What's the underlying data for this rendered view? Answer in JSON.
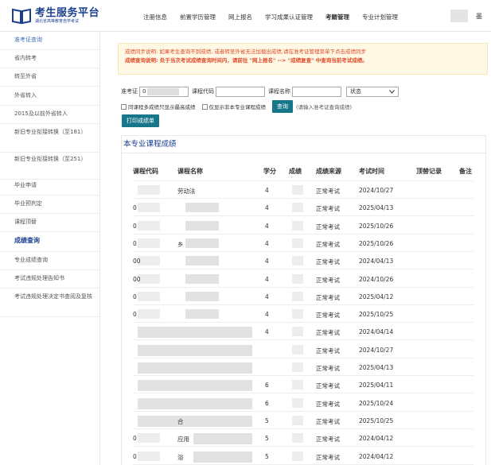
{
  "header": {
    "logo_title": "考生服务平台",
    "logo_subtitle": "湖北省高等教育自学考试",
    "nav": [
      "注册信息",
      "前置学历管理",
      "网上报名",
      "学习成果认证管理",
      "考籍管理",
      "专业计划管理"
    ],
    "active_nav": "考籍管理",
    "user_trailing_char": "墨"
  },
  "sidebar": {
    "items": [
      "准考证查询",
      "省内转考",
      "转至外省",
      "外省转入",
      "2015及以前外省转入",
      "新旧专业衔接转换（至181）",
      "新旧专业衔接转换（至251）",
      "毕业申请",
      "毕业预判定",
      "课程顶替",
      "成绩查询",
      "专业成绩查询",
      "考试违规处理告知书",
      "考试违规处理决定书查阅及复核"
    ],
    "active_index": 10
  },
  "notice": {
    "line1": "成绩同步说明: 如果考生查询不到成绩, 或者转至外省无法加载出成绩,请在准考证管理菜单下点击成绩同步",
    "line2": "成绩查询说明: 处于当次考试成绩查询时间内，请前往 \"网上报名\" --> \"成绩复查\" 中查询当前考试成绩。"
  },
  "search": {
    "id_label": "准考证",
    "id_value": "0",
    "code_label": "课程代码",
    "code_value": "",
    "name_label": "课程名称",
    "name_value": "",
    "status_value": "状态",
    "check1_label": "同课程多成绩只显示最高成绩",
    "check2_label": "仅显示非本专业课程成绩",
    "query_button": "查询",
    "hint": "(请输入准考证查询成绩)",
    "print_button": "打印成绩单"
  },
  "panel": {
    "title": "本专业课程成绩",
    "columns": [
      "课程代码",
      "课程名称",
      "学分",
      "成绩",
      "成绩来源",
      "考试时间",
      "顶替记录",
      "备注"
    ],
    "rows": [
      {
        "code": "",
        "name": "劳动法",
        "credit": "4",
        "source": "正常考试",
        "time": "2024/10/27"
      },
      {
        "code": "0",
        "name": "",
        "credit": "4",
        "source": "正常考试",
        "time": "2025/04/13"
      },
      {
        "code": "0",
        "name": "",
        "credit": "4",
        "source": "正常考试",
        "time": "2025/10/26"
      },
      {
        "code": "0",
        "name": "乡",
        "credit": "4",
        "source": "正常考试",
        "time": "2025/10/26"
      },
      {
        "code": "00",
        "name": "",
        "credit": "4",
        "source": "正常考试",
        "time": "2024/04/13"
      },
      {
        "code": "00",
        "name": "",
        "credit": "4",
        "source": "正常考试",
        "time": "2024/10/26"
      },
      {
        "code": "0",
        "name": "",
        "credit": "4",
        "source": "正常考试",
        "time": "2025/04/12"
      },
      {
        "code": "0",
        "name": "",
        "credit": "4",
        "source": "正常考试",
        "time": "2025/10/25"
      },
      {
        "code": "",
        "name": "",
        "credit": "4",
        "source": "正常考试",
        "time": "2024/04/14"
      },
      {
        "code": "",
        "name": "",
        "credit": "",
        "source": "正常考试",
        "time": "2024/10/27"
      },
      {
        "code": "",
        "name": "",
        "credit": "",
        "source": "正常考试",
        "time": "2025/04/13"
      },
      {
        "code": "",
        "name": "",
        "credit": "6",
        "source": "正常考试",
        "time": "2025/04/11"
      },
      {
        "code": "",
        "name": "",
        "credit": "6",
        "source": "正常考试",
        "time": "2025/10/24"
      },
      {
        "code": "",
        "name": "合",
        "credit": "5",
        "source": "正常考试",
        "time": "2025/10/25"
      },
      {
        "code": "0",
        "name": "应用",
        "credit": "5",
        "source": "正常考试",
        "time": "2024/04/12"
      },
      {
        "code": "0",
        "name": "浴",
        "credit": "5",
        "source": "正常考试",
        "time": "2024/04/12"
      }
    ]
  },
  "colors": {
    "brand": "#1a3f8f",
    "button": "#17768a",
    "notice_bg": "#fef8e4",
    "notice_text": "#e04a2a"
  }
}
